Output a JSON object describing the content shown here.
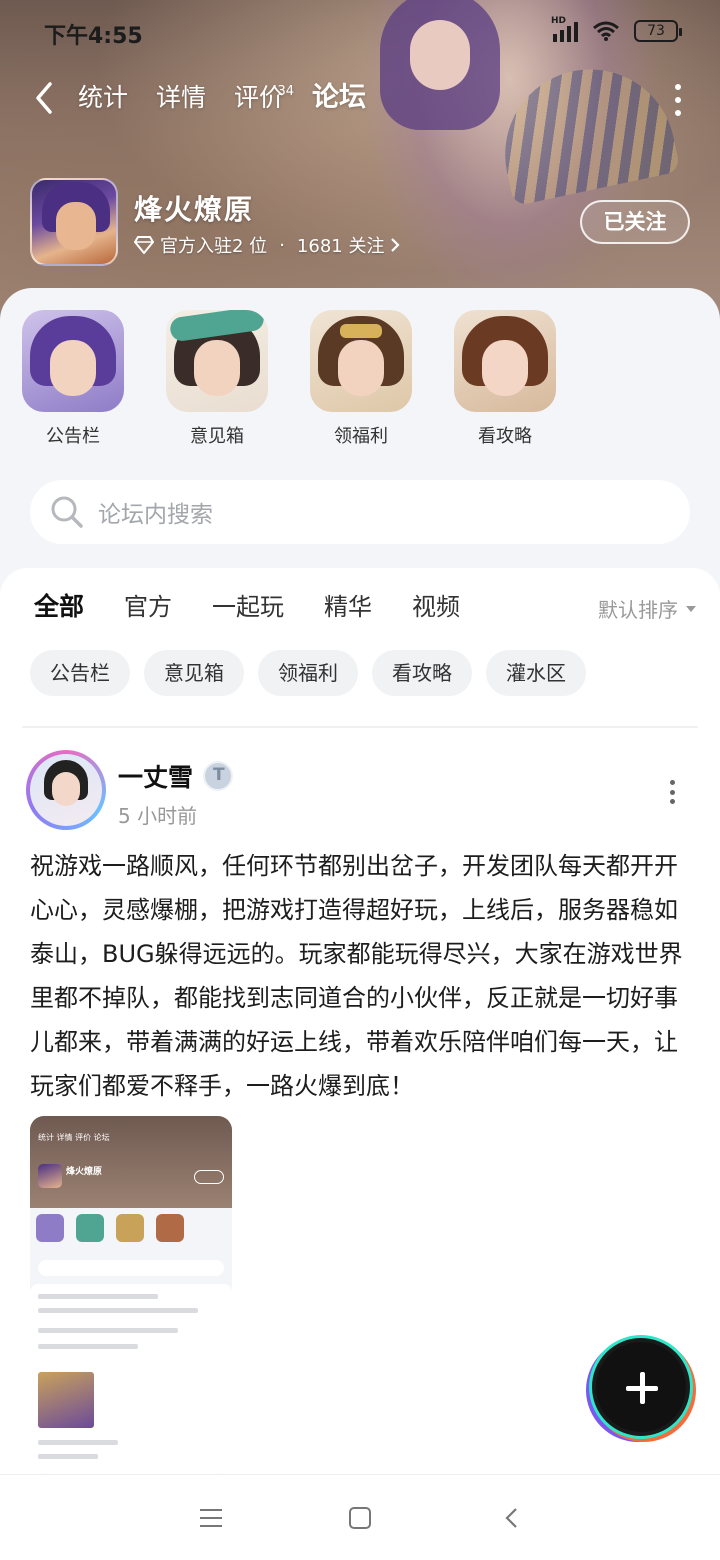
{
  "status_bar": {
    "time": "下午4:55",
    "network_tag": "HD",
    "battery": "73"
  },
  "nav": {
    "tabs": [
      {
        "label": "统计",
        "active": false
      },
      {
        "label": "详情",
        "active": false
      },
      {
        "label": "评价",
        "active": false,
        "badge": "34"
      },
      {
        "label": "论坛",
        "active": true
      }
    ]
  },
  "game": {
    "name": "烽火燎原",
    "official_text": "官方入驻2 位",
    "separator": "·",
    "followers_text": "1681 关注",
    "follow_button": "已关注"
  },
  "quick_links": [
    {
      "label": "公告栏"
    },
    {
      "label": "意见箱"
    },
    {
      "label": "领福利"
    },
    {
      "label": "看攻略"
    }
  ],
  "search": {
    "placeholder": "论坛内搜索"
  },
  "filter_tabs": [
    {
      "label": "全部",
      "active": true
    },
    {
      "label": "官方",
      "active": false
    },
    {
      "label": "一起玩",
      "active": false
    },
    {
      "label": "精华",
      "active": false
    },
    {
      "label": "视频",
      "active": false
    }
  ],
  "sort": {
    "label": "默认排序"
  },
  "chips": [
    "公告栏",
    "意见箱",
    "领福利",
    "看攻略",
    "灌水区"
  ],
  "post": {
    "author": "一丈雪",
    "time": "5 小时前",
    "body": "祝游戏一路顺风，任何环节都别出岔子，开发团队每天都开开心心，灵感爆棚，把游戏打造得超好玩，上线后，服务器稳如泰山，BUG躲得远远的。玩家都能玩得尽兴，大家在游戏世界里都不掉队，都能找到志同道合的小伙伴，反正就是一切好事儿都来，带着满满的好运上线，带着欢乐陪伴咱们每一天，让玩家们都爱不释手，一路火爆到底！",
    "thumb_preview": {
      "nav": "统计  详情  评价  论坛",
      "game_name": "烽火燎原"
    }
  },
  "colors": {
    "accent": "#36d6b9",
    "panel_bg": "#f3f5f8"
  }
}
